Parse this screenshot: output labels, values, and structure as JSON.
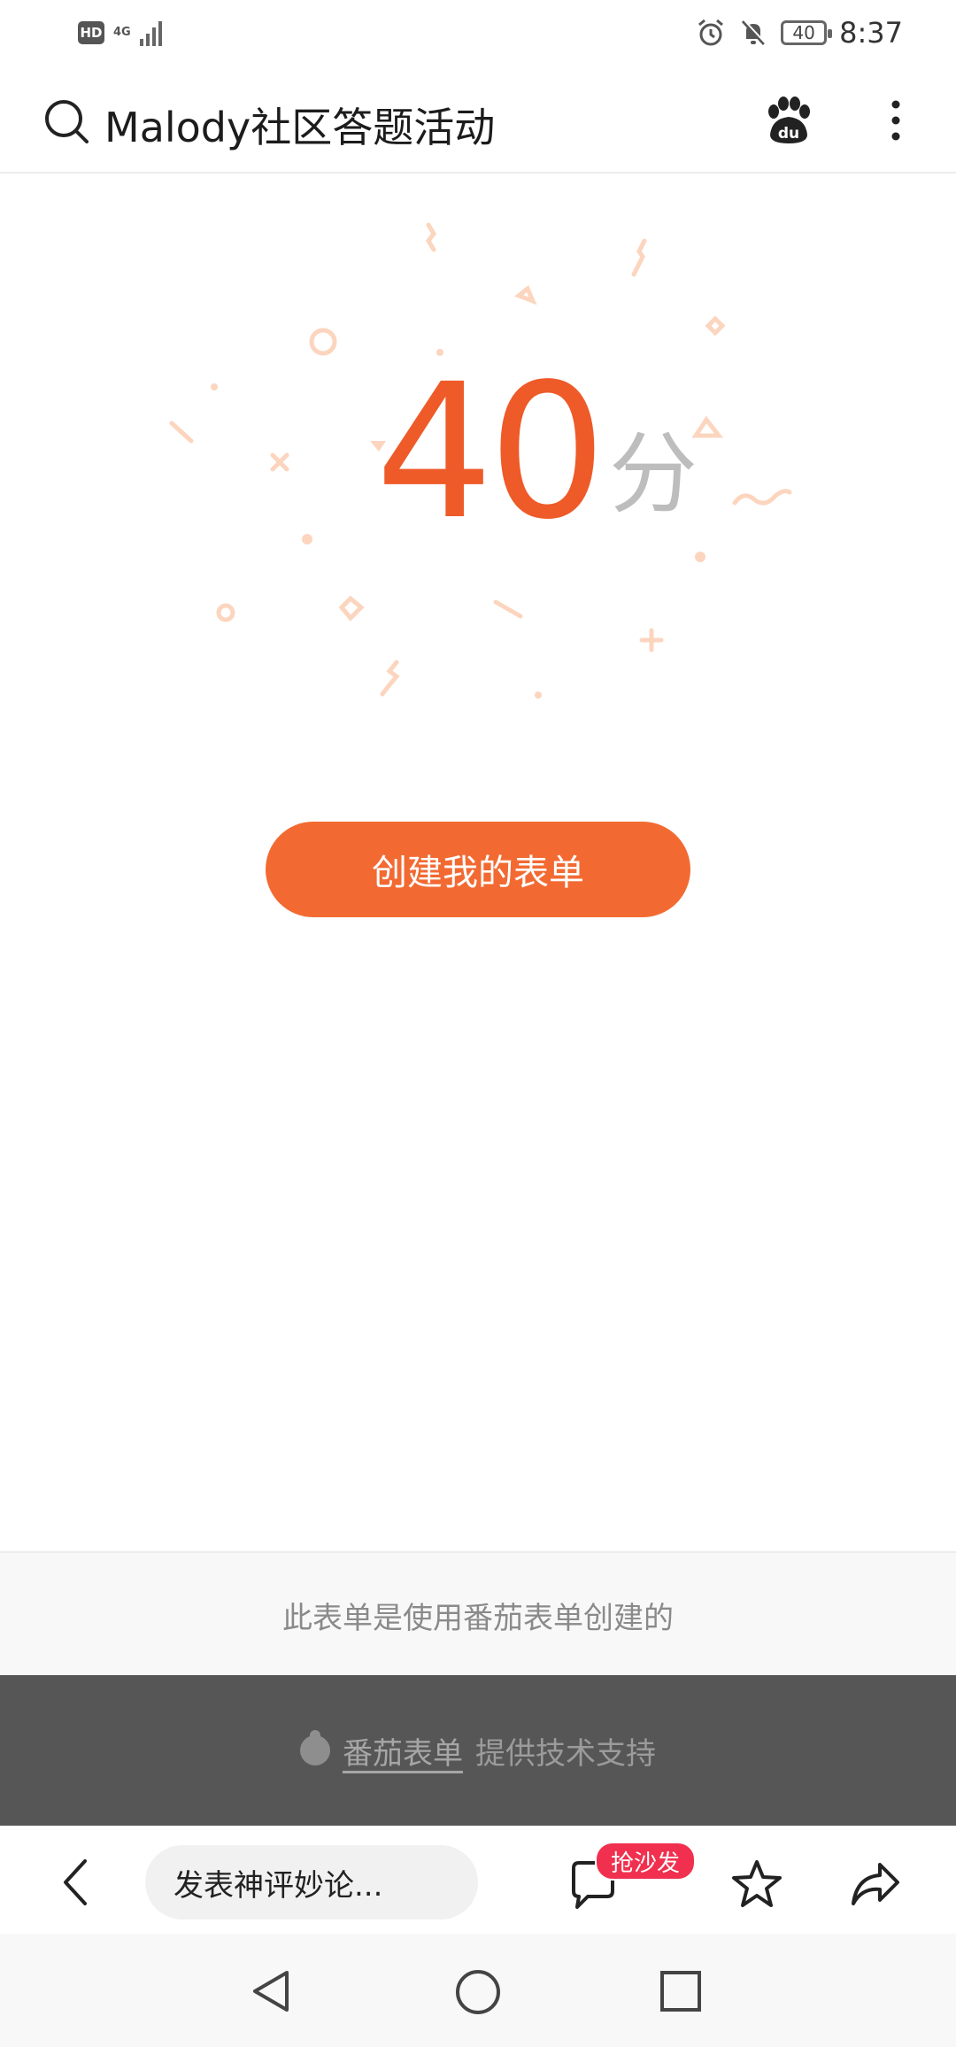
{
  "status_bar": {
    "hd_label": "HD",
    "network_label": "4G",
    "battery_level": "40",
    "time": "8:37"
  },
  "header": {
    "title": "Malody社区答题活动",
    "search_icon": "search-icon",
    "logo_icon": "baidu-paw-icon",
    "menu_icon": "more-vertical-icon"
  },
  "result": {
    "score": "40",
    "unit": "分",
    "score_color": "#ee5a28"
  },
  "actions": {
    "create_form_label": "创建我的表单",
    "button_color": "#f26a32"
  },
  "footer": {
    "note": "此表单是使用番茄表单创建的",
    "brand_name": "番茄表单",
    "support_text": "提供技术支持"
  },
  "toolbar": {
    "comment_placeholder": "发表神评妙论...",
    "sofa_badge": "抢沙发",
    "badge_color": "#f0304e"
  },
  "nav": {
    "back_icon": "triangle-back-icon",
    "home_icon": "circle-home-icon",
    "recent_icon": "square-recent-icon"
  }
}
